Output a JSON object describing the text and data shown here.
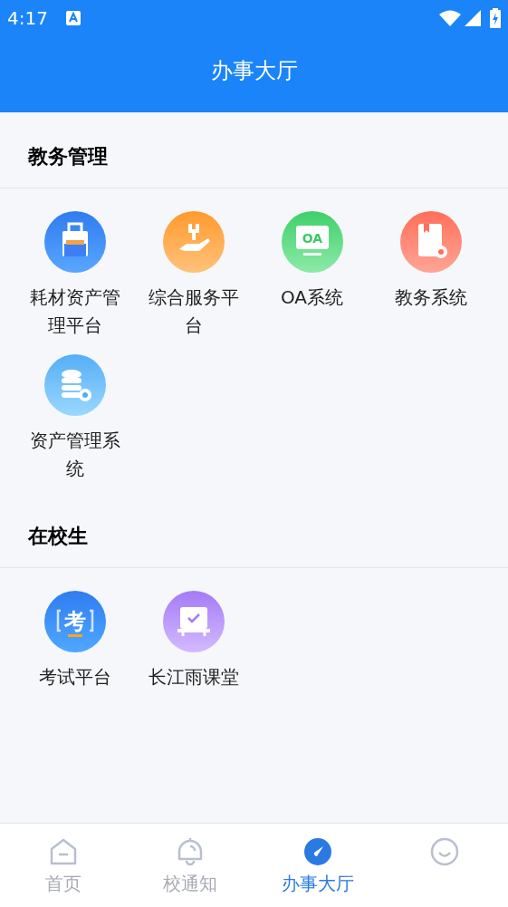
{
  "status_bar": {
    "time": "4:17"
  },
  "header": {
    "title": "办事大厅"
  },
  "sections": [
    {
      "title": "教务管理",
      "items": [
        {
          "label": "耗材资产管理平台",
          "kind": "bag"
        },
        {
          "label": "综合服务平台",
          "kind": "hand"
        },
        {
          "label": "OA系统",
          "kind": "oa",
          "icon_text": "OA"
        },
        {
          "label": "教务系统",
          "kind": "doc"
        },
        {
          "label": "资产管理系统",
          "kind": "db"
        }
      ]
    },
    {
      "title": "在校生",
      "items": [
        {
          "label": "考试平台",
          "kind": "exam",
          "icon_text": "考"
        },
        {
          "label": "长江雨课堂",
          "kind": "class"
        }
      ]
    }
  ],
  "tabs": [
    {
      "label": "首页",
      "kind": "home",
      "selected": false
    },
    {
      "label": "校通知",
      "kind": "bell",
      "selected": false
    },
    {
      "label": "办事大厅",
      "kind": "compass",
      "selected": true
    },
    {
      "kind": "smile",
      "selected": false
    }
  ]
}
